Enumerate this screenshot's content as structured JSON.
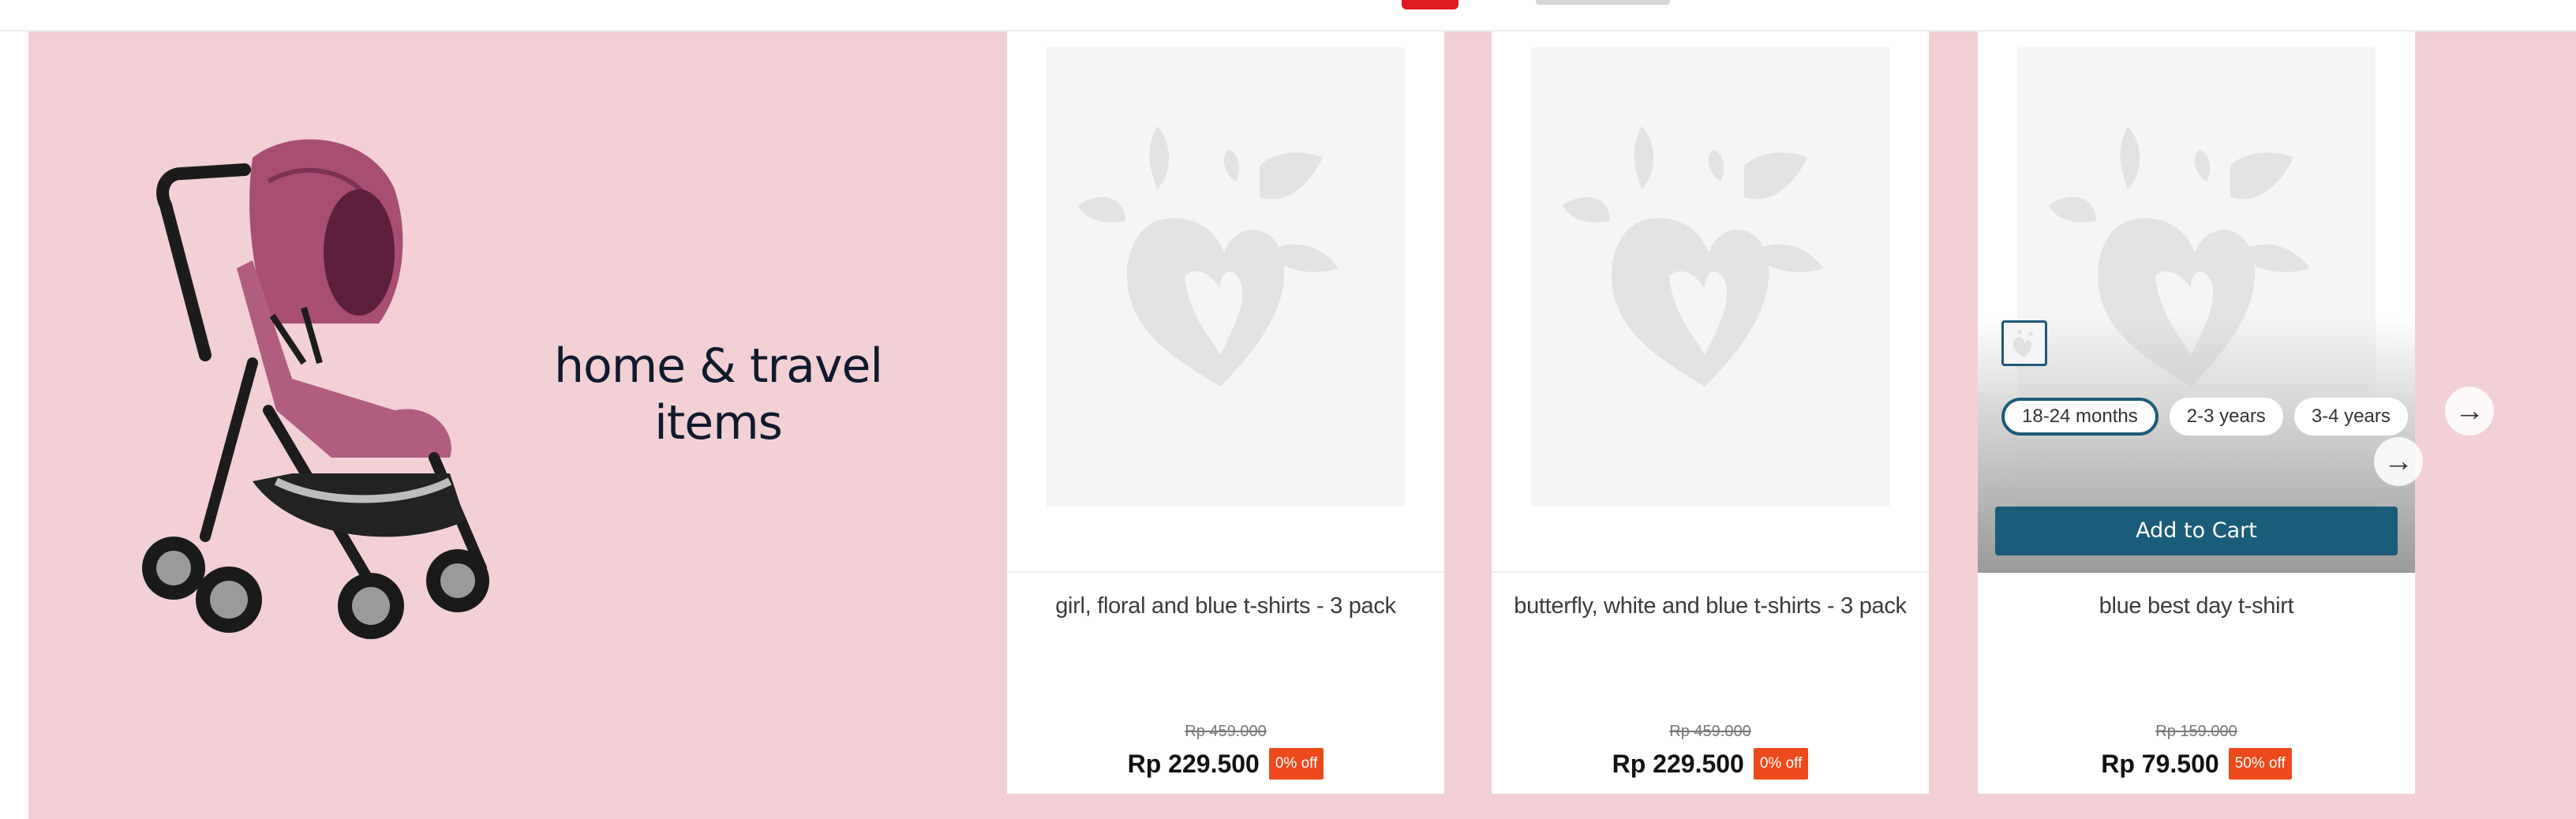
{
  "promo": {
    "title_line1": "home & travel",
    "title_line2": "items"
  },
  "products": [
    {
      "name": "girl, floral and blue t-shirts - 3 pack",
      "old_price": "Rp 459.000",
      "price": "Rp 229.500",
      "discount": "0% off"
    },
    {
      "name": "butterfly, white and blue t-shirts - 3 pack",
      "old_price": "Rp 459.000",
      "price": "Rp 229.500",
      "discount": "0% off"
    },
    {
      "name": "blue best day t-shirt",
      "old_price": "Rp 159.000",
      "price": "Rp 79.500",
      "discount": "50% off",
      "sizes": [
        "18-24 months",
        "2-3 years",
        "3-4 years"
      ],
      "selected_size": "18-24 months",
      "add_to_cart_label": "Add to Cart"
    }
  ],
  "icons": {
    "next_arrow": "arrow-right-icon",
    "placeholder": "brand-heart-logo-icon"
  },
  "colors": {
    "banner_bg": "#f2d0d6",
    "accent": "#1b5c7a",
    "discount": "#ec4a1c",
    "top_mark": "#e01b22"
  }
}
